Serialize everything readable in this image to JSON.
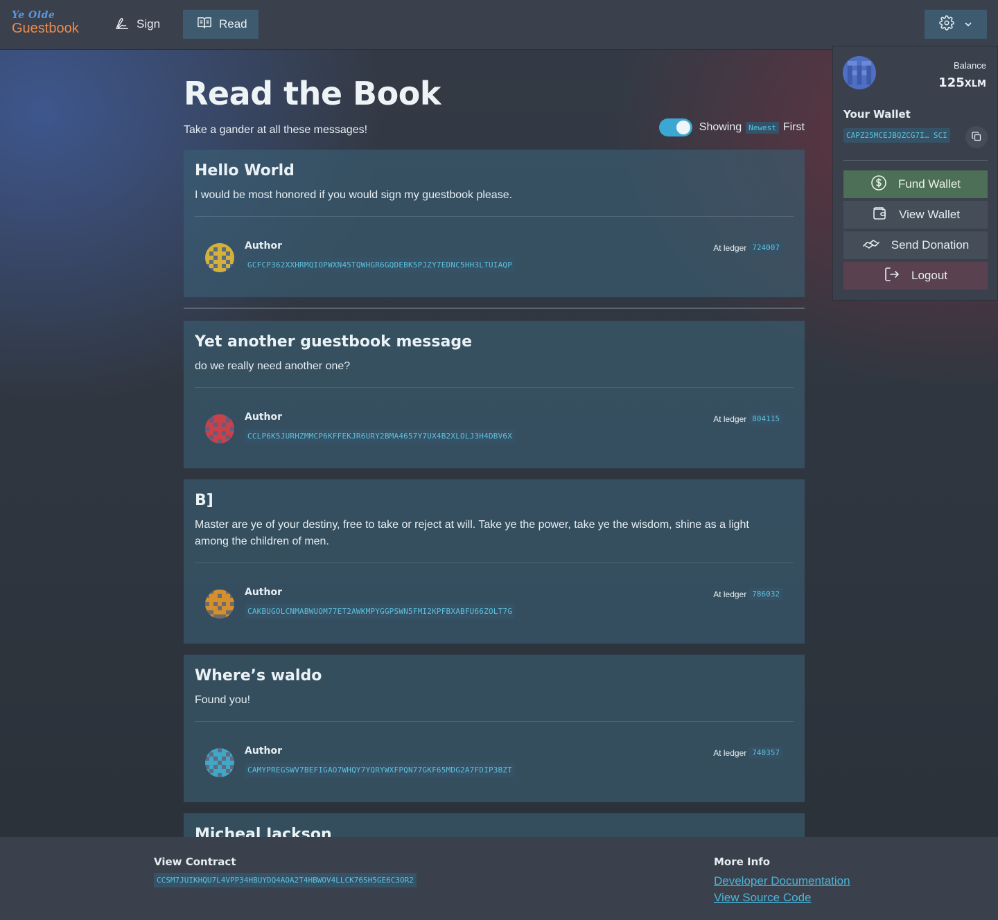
{
  "nav": {
    "logo_top": "Ye Olde",
    "logo_bottom": "Guestbook",
    "sign_label": "Sign",
    "read_label": "Read"
  },
  "page": {
    "title": "Read the Book",
    "subtitle": "Take a gander at all these messages!",
    "toggle": {
      "on": true,
      "prefix": "Showing",
      "order": "Newest",
      "suffix": "First"
    }
  },
  "messages": [
    {
      "title": "Hello World",
      "body": "I would be most honored if you would sign my guestbook please.",
      "author_label": "Author",
      "author": "GCFCP362XXHRMQIOPWXN45TQWHGR6GQDEBK5PJZY7EDNC5HH3LTUIAQP",
      "ledger_label": "At ledger",
      "ledger": "724007",
      "avatar_color": "#d4b23a"
    },
    {
      "title": "Yet another guestbook message",
      "body": "do we really need another one?",
      "author_label": "Author",
      "author": "CCLP6K5JURHZMMCP6KFFEKJR6URY2BMA4657Y7UX4B2XLOLJ3H4DBV6X",
      "ledger_label": "At ledger",
      "ledger": "804115",
      "avatar_color": "#c8424a"
    },
    {
      "title": "B]",
      "body": "Master are ye of your destiny, free to take or reject at will. Take ye the power, take ye the wisdom, shine as a light among the children of men.",
      "author_label": "Author",
      "author": "CAKBUGOLCNMABWUOM77ET2AWKMPYGGPSWN5FMI2KPFBXABFU66ZOLT7G",
      "ledger_label": "At ledger",
      "ledger": "786032",
      "avatar_color": "#d4902c"
    },
    {
      "title": "Where’s waldo",
      "body": "Found you!",
      "author_label": "Author",
      "author": "CAMYPREGSWV7BEFIGAO7WHQY7YQRYWXFPQN77GKF65MDG2A7FDIP3BZT",
      "ledger_label": "At ledger",
      "ledger": "740357",
      "avatar_color": "#3fa8c8"
    },
    {
      "title": "Micheal Jackson"
    }
  ],
  "wallet_panel": {
    "balance_label": "Balance",
    "balance_value": "125",
    "balance_unit": "XLM",
    "wallet_label": "Your Wallet",
    "wallet_address": "CAPZ25MCEJBQZCG7I… SCI",
    "fund_label": "Fund Wallet",
    "view_label": "View Wallet",
    "send_label": "Send Donation",
    "logout_label": "Logout"
  },
  "footer": {
    "contract_heading": "View Contract",
    "contract_id": "CCSM7JUIKHQU7L4VPP34HBUYDQ4AOA2T4HBWOV4LLCK76SH5GE6C3OR2",
    "more_heading": "More Info",
    "docs_link": "Developer Documentation",
    "source_link": "View Source Code"
  },
  "colors": {
    "accent": "#3ba8d4",
    "logo_blue": "#5d95e0",
    "logo_orange": "#f08a4b",
    "mono_text": "#5ec2dd",
    "fund_button": "#4d6e57",
    "logout_button": "#5a4150"
  },
  "icons": {
    "sign": "signature-icon",
    "read": "open-book-icon",
    "settings": "gear-icon",
    "dropdown": "chevron-down-icon",
    "copy": "copy-icon",
    "fund": "dollar-circle-icon",
    "view": "wallet-icon",
    "send": "handshake-icon",
    "logout": "logout-icon"
  }
}
